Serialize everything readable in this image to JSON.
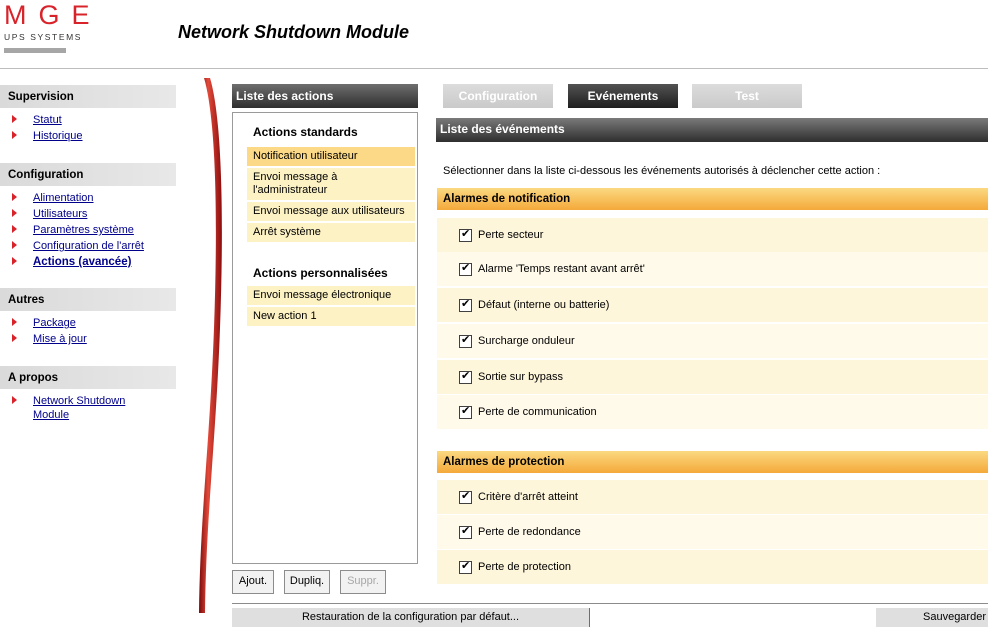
{
  "header": {
    "logo_main": "MGE",
    "logo_sub": "UPS SYSTEMS",
    "app_title": "Network Shutdown Module"
  },
  "sidebar": {
    "sections": [
      {
        "title": "Supervision",
        "items": [
          {
            "label": "Statut"
          },
          {
            "label": "Historique"
          }
        ]
      },
      {
        "title": "Configuration",
        "items": [
          {
            "label": "Alimentation"
          },
          {
            "label": "Utilisateurs"
          },
          {
            "label": "Paramètres système"
          },
          {
            "label": "Configuration de l'arrêt"
          },
          {
            "label": "Actions (avancée)",
            "active": true
          }
        ]
      },
      {
        "title": "Autres",
        "items": [
          {
            "label": "Package"
          },
          {
            "label": "Mise à jour"
          }
        ]
      },
      {
        "title": "A propos",
        "items": [
          {
            "label": "Network Shutdown Module"
          }
        ]
      }
    ]
  },
  "actions_panel": {
    "title": "Liste des actions",
    "standard_title": "Actions standards",
    "standard_items": [
      "Notification utilisateur",
      "Envoi message à l'administrateur",
      "Envoi message aux utilisateurs",
      "Arrêt système"
    ],
    "custom_title": "Actions personnalisées",
    "custom_items": [
      "Envoi message électronique",
      "New action 1"
    ],
    "buttons": {
      "add": "Ajout.",
      "duplicate": "Dupliq.",
      "delete": "Suppr."
    }
  },
  "tabs": {
    "configuration": "Configuration",
    "events": "Evénements",
    "test": "Test"
  },
  "events_panel": {
    "title": "Liste des événements",
    "instructions": "Sélectionner dans la liste ci-dessous les événements autorisés à déclencher cette action :",
    "notification_title": "Alarmes de notification",
    "notification_items": [
      "Perte secteur",
      "Alarme 'Temps restant avant arrêt'",
      "Défaut (interne ou batterie)",
      "Surcharge onduleur",
      "Sortie sur bypass",
      "Perte de communication"
    ],
    "protection_title": "Alarmes de protection",
    "protection_items": [
      "Critère d'arrêt atteint",
      "Perte de redondance",
      "Perte de protection"
    ]
  },
  "footer": {
    "restore_label": "Restauration de la configuration par défaut...",
    "save_label": "Sauvegarder"
  },
  "colors": {
    "brand_red": "#d8232a",
    "link_blue": "#00008b",
    "section_orange": "#f4a93a",
    "selected_action": "#fcd986",
    "action_bg": "#fdf2c4"
  }
}
